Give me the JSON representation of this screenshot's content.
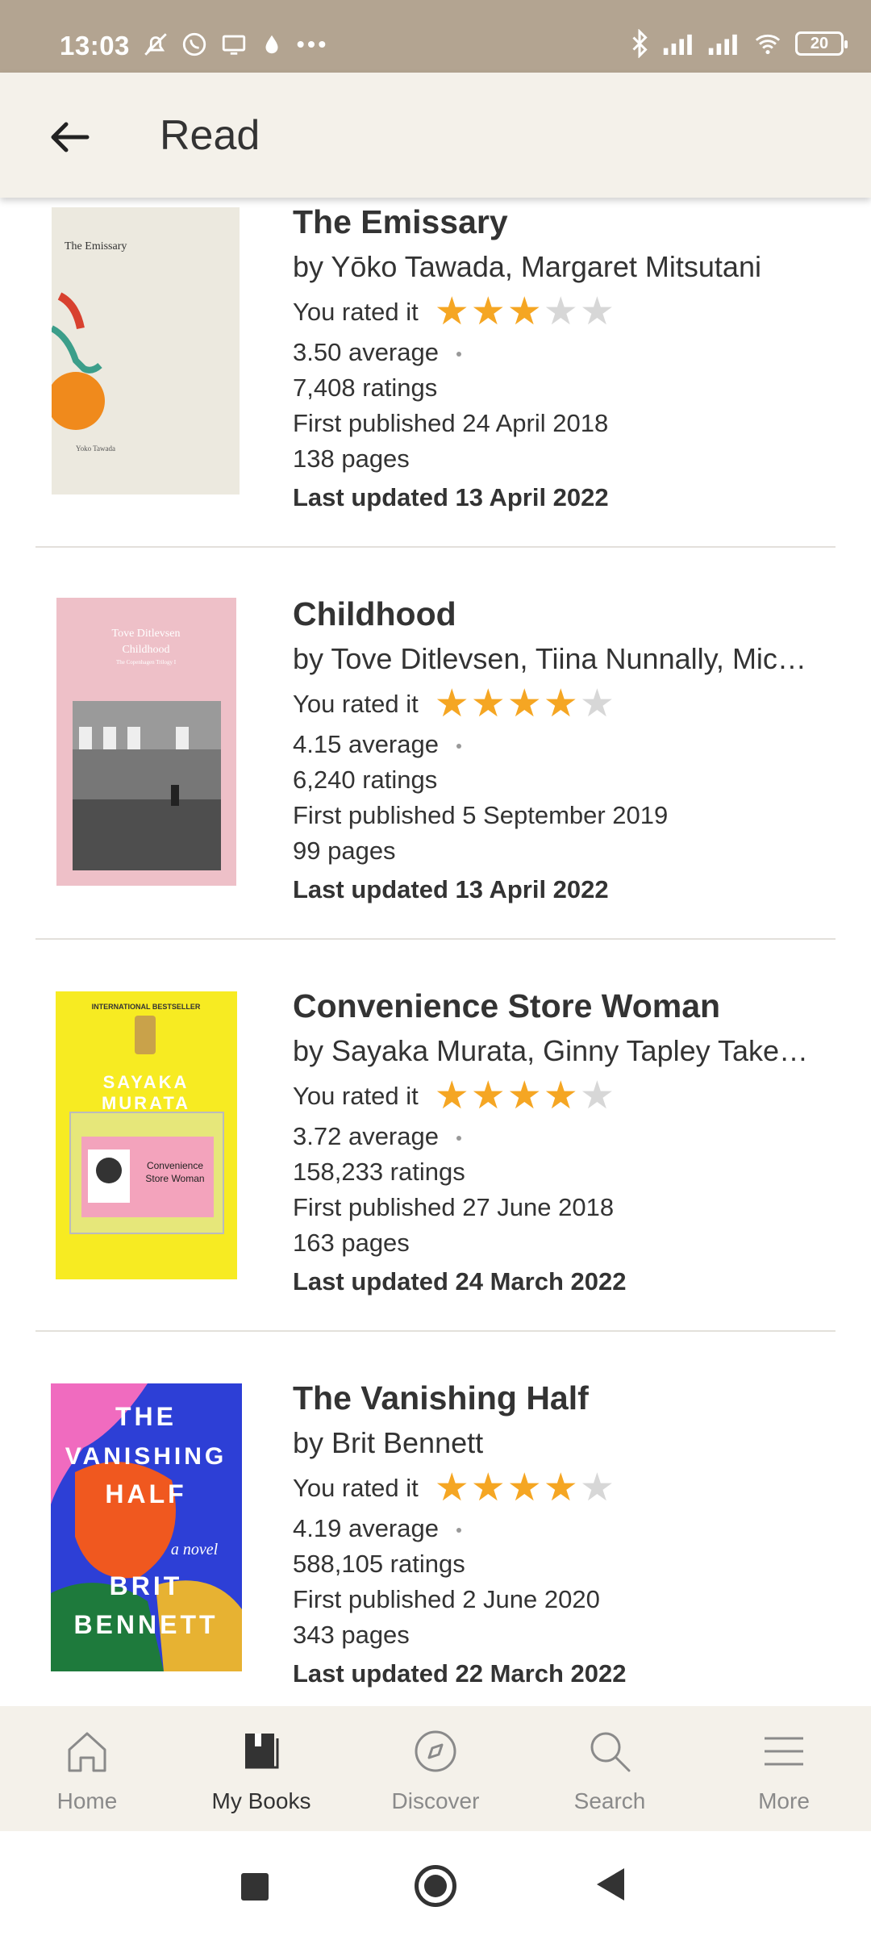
{
  "status_bar": {
    "time": "13:03",
    "battery": "20",
    "left_icons": [
      "bell-off-icon",
      "whatsapp-icon",
      "screen-icon",
      "drop-icon",
      "more-dots-icon"
    ],
    "right_icons": [
      "bluetooth-icon",
      "signal-r-icon",
      "signal-icon",
      "wifi-icon",
      "battery-icon"
    ]
  },
  "header": {
    "title": "Read",
    "back_icon": "arrow-left-icon"
  },
  "labels": {
    "you_rated": "You rated it"
  },
  "books": [
    {
      "title": "The Emissary",
      "authors": "by Yōko Tawada, Margaret Mitsutani",
      "rating": 3,
      "average": "3.50 average",
      "ratings": "7,408 ratings",
      "first_published": "First published 24 April 2018",
      "pages": "138 pages",
      "last_updated": "Last updated 13 April 2022",
      "cover": {
        "title": "The Emissary",
        "author": "Yoko Tawada",
        "bg": "#ece9df"
      }
    },
    {
      "title": "Childhood",
      "authors": "by Tove Ditlevsen, Tiina Nunnally, Mic…",
      "rating": 4,
      "average": "4.15 average",
      "ratings": "6,240 ratings",
      "first_published": "First published 5 September 2019",
      "pages": "99 pages",
      "last_updated": "Last updated 13 April 2022",
      "cover": {
        "title": "Tove Ditlevsen\nChildhood",
        "series": "The Copenhagen Trilogy I",
        "bg": "#eec0c8"
      }
    },
    {
      "title": "Convenience Store Woman",
      "authors": "by Sayaka Murata, Ginny Tapley Take…",
      "rating": 4,
      "average": "3.72 average",
      "ratings": "158,233 ratings",
      "first_published": "First published 27 June 2018",
      "pages": "163 pages",
      "last_updated": "Last updated 24 March 2022",
      "cover": {
        "tag": "INTERNATIONAL BESTSELLER",
        "author": "SAYAKA MURATA",
        "title": "Convenience Store Woman",
        "bg": "#f7eb22"
      }
    },
    {
      "title": "The Vanishing Half",
      "authors": "by Brit Bennett",
      "rating": 4,
      "average": "4.19 average",
      "ratings": "588,105 ratings",
      "first_published": "First published 2 June 2020",
      "pages": "343 pages",
      "last_updated": "Last updated 22 March 2022",
      "cover": {
        "title": "THE VANISHING HALF",
        "author": "BRIT BENNETT",
        "subtitle": "a novel"
      }
    }
  ],
  "bottom_nav": [
    {
      "label": "Home",
      "icon": "home-icon",
      "active": false
    },
    {
      "label": "My Books",
      "icon": "my-books-icon",
      "active": true
    },
    {
      "label": "Discover",
      "icon": "compass-icon",
      "active": false
    },
    {
      "label": "Search",
      "icon": "search-icon",
      "active": false
    },
    {
      "label": "More",
      "icon": "menu-icon",
      "active": false
    }
  ],
  "colors": {
    "status_bar": "#b3a491",
    "header_bg": "#f4f1ea",
    "star_on": "#f5a623",
    "star_off": "#d7d7d7",
    "text": "#333333"
  }
}
